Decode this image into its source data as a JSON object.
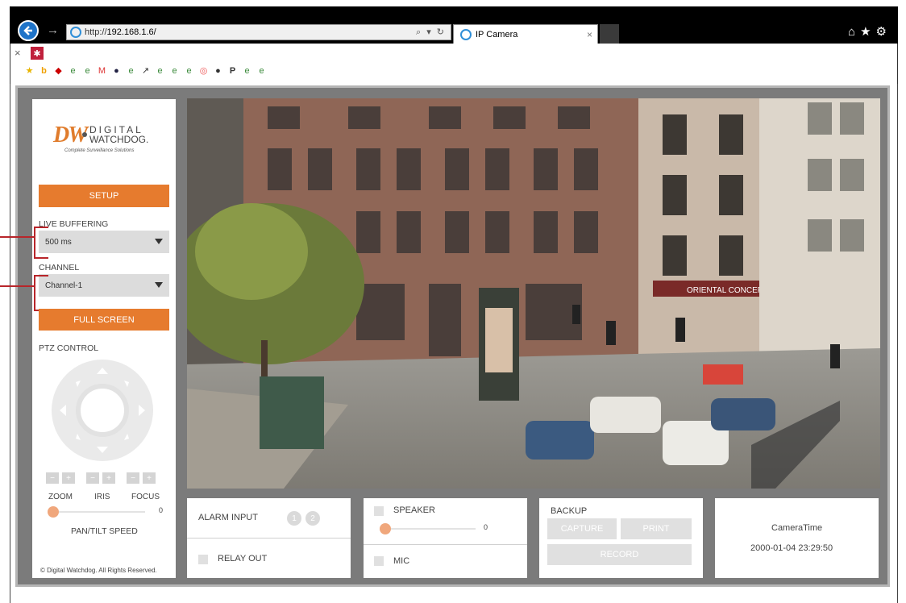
{
  "browser": {
    "url_prefix": "http://",
    "url_host": "192.168.1.6/",
    "addr_controls": "⌕ ▾ ↻",
    "tab_title": "IP Camera",
    "tab_close": "×",
    "right_icons": "⌂★⚙"
  },
  "brand": {
    "mark": "DW",
    "line1": "DIGITAL",
    "line2": "WATCHDOG.",
    "tagline": "Complete Surveillance Solutions"
  },
  "sidebar": {
    "setup_label": "SETUP",
    "buffering_label": "LIVE BUFFERING",
    "buffering_value": "500 ms",
    "channel_label": "CHANNEL",
    "channel_value": "Channel-1",
    "fullscreen_label": "FULL SCREEN",
    "ptz_label": "PTZ CONTROL",
    "zoom_label": "ZOOM",
    "iris_label": "IRIS",
    "focus_label": "FOCUS",
    "minus": "−",
    "plus": "+",
    "pan_speed_value": "0",
    "pan_speed_label": "PAN/TILT SPEED",
    "copyright": "© Digital Watchdog. All Rights Reserved."
  },
  "panels": {
    "alarm_input_label": "ALARM INPUT",
    "alarm_1": "1",
    "alarm_2": "2",
    "relay_out_label": "RELAY OUT",
    "speaker_label": "SPEAKER",
    "speaker_value": "0",
    "mic_label": "MIC",
    "backup_label": "BACKUP",
    "capture_label": "CAPTURE",
    "print_label": "PRINT",
    "record_label": "RECORD",
    "camera_time_label": "CameraTime",
    "camera_time_value": "2000-01-04 23:29:50"
  },
  "camera_overlay": {
    "shop_sign": "ORIENTAL CONCEPTS"
  },
  "colors": {
    "accent": "#e67b2e",
    "frame": "#7b7b7b",
    "callout": "#b8252a"
  }
}
